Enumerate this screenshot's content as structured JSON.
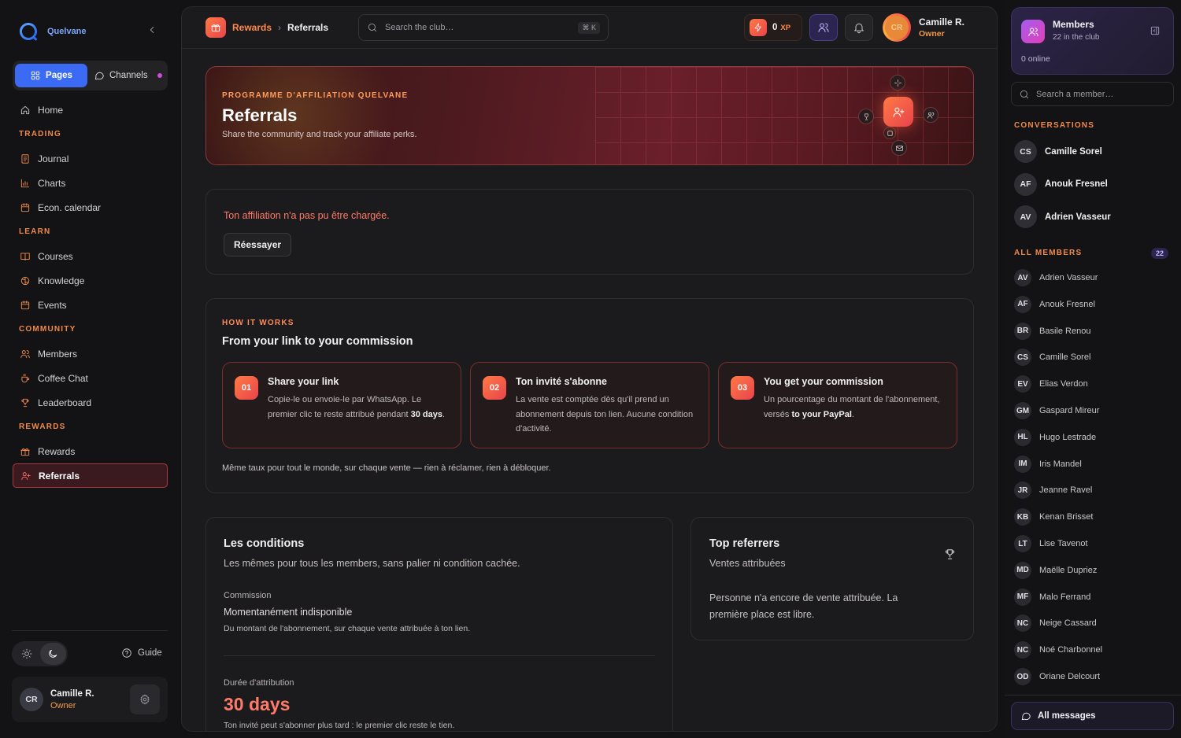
{
  "app": {
    "name": "Quelvane"
  },
  "sidebar": {
    "seg_pages": "Pages",
    "seg_channels": "Channels",
    "home": "Home",
    "sections": [
      {
        "title": "TRADING",
        "items": [
          "Journal",
          "Charts",
          "Econ. calendar"
        ]
      },
      {
        "title": "LEARN",
        "items": [
          "Courses",
          "Knowledge",
          "Events"
        ]
      },
      {
        "title": "COMMUNITY",
        "items": [
          "Members",
          "Coffee Chat",
          "Leaderboard"
        ]
      },
      {
        "title": "REWARDS",
        "items": [
          "Rewards",
          "Referrals"
        ]
      }
    ],
    "active_item": "Referrals",
    "guide": "Guide",
    "user": {
      "initials": "CR",
      "name": "Camille R.",
      "role": "Owner"
    }
  },
  "topbar": {
    "breadcrumb": [
      "Rewards",
      "Referrals"
    ],
    "search_placeholder": "Search the club…",
    "shortcut": "⌘ K",
    "xp_value": "0",
    "xp_label": "XP",
    "user": {
      "initials": "CR",
      "name": "Camille R.",
      "role": "Owner"
    }
  },
  "hero": {
    "kicker": "PROGRAMME D'AFFILIATION QUELVANE",
    "title": "Referrals",
    "subtitle": "Share the community and track your affiliate perks."
  },
  "error": {
    "message": "Ton affiliation n'a pas pu être chargée.",
    "retry": "Réessayer"
  },
  "how": {
    "kicker": "HOW IT WORKS",
    "title": "From your link to your commission",
    "steps": [
      {
        "n": "01",
        "title": "Share your link",
        "desc_a": "Copie-le ou envoie-le par WhatsApp. Le premier clic te reste attribué pendant ",
        "desc_b": "30 days",
        "desc_c": "."
      },
      {
        "n": "02",
        "title": "Ton invité s'abonne",
        "desc_a": "La vente est comptée dès qu'il prend un abonnement depuis ton lien. Aucune condition d'activité.",
        "desc_b": "",
        "desc_c": ""
      },
      {
        "n": "03",
        "title": "You get your commission",
        "desc_a": "Un pourcentage du montant de l'abonnement, versés ",
        "desc_b": "to your PayPal",
        "desc_c": "."
      }
    ],
    "footer": "Même taux pour tout le monde, sur chaque vente — rien à réclamer, rien à débloquer."
  },
  "conditions": {
    "title": "Les conditions",
    "subtitle": "Les mêmes pour tous les members, sans palier ni condition cachée.",
    "commission_label": "Commission",
    "commission_value": "Momentanément indisponible",
    "commission_note": "Du montant de l'abonnement, sur chaque vente attribuée à ton lien.",
    "duration_label": "Durée d'attribution",
    "duration_value": "30 days",
    "duration_note": "Ton invité peut s'abonner plus tard : le premier clic reste le tien."
  },
  "top_referrers": {
    "title": "Top referrers",
    "subtitle": "Ventes attribuées",
    "empty": "Personne n'a encore de vente attribuée. La première place est libre."
  },
  "right": {
    "members_title": "Members",
    "members_sub": "22 in the club",
    "online": "0 online",
    "search_placeholder": "Search a member…",
    "conversations_title": "CONVERSATIONS",
    "conversations": [
      {
        "initials": "CS",
        "name": "Camille Sorel"
      },
      {
        "initials": "AF",
        "name": "Anouk Fresnel"
      },
      {
        "initials": "AV",
        "name": "Adrien Vasseur"
      }
    ],
    "all_members_title": "ALL MEMBERS",
    "all_members_count": "22",
    "members": [
      {
        "initials": "AV",
        "name": "Adrien Vasseur"
      },
      {
        "initials": "AF",
        "name": "Anouk Fresnel"
      },
      {
        "initials": "BR",
        "name": "Basile Renou"
      },
      {
        "initials": "CS",
        "name": "Camille Sorel"
      },
      {
        "initials": "EV",
        "name": "Elias Verdon"
      },
      {
        "initials": "GM",
        "name": "Gaspard Mireur"
      },
      {
        "initials": "HL",
        "name": "Hugo Lestrade"
      },
      {
        "initials": "IM",
        "name": "Iris Mandel"
      },
      {
        "initials": "JR",
        "name": "Jeanne Ravel"
      },
      {
        "initials": "KB",
        "name": "Kenan Brisset"
      },
      {
        "initials": "LT",
        "name": "Lise Tavenot"
      },
      {
        "initials": "MD",
        "name": "Maëlle Dupriez"
      },
      {
        "initials": "MF",
        "name": "Malo Ferrand"
      },
      {
        "initials": "NC",
        "name": "Neige Cassard"
      },
      {
        "initials": "NC",
        "name": "Noé Charbonnel"
      },
      {
        "initials": "OD",
        "name": "Oriane Delcourt"
      }
    ],
    "all_messages": "All messages"
  },
  "colors": {
    "accent": "#ff7a45",
    "accent2": "#e8434b",
    "purple": "#a55cf0",
    "error": "#ff7a6a"
  }
}
